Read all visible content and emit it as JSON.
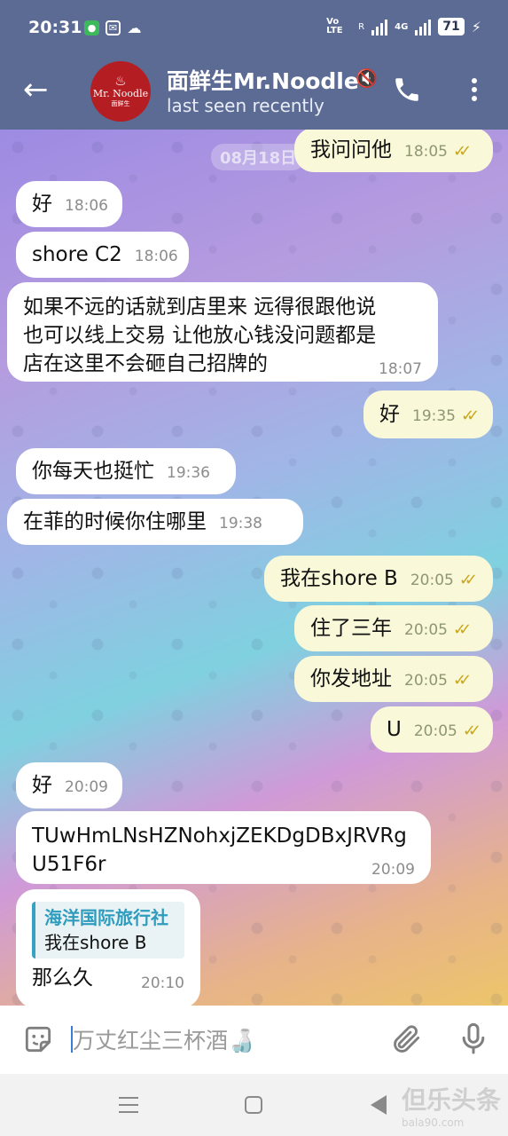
{
  "status_bar": {
    "time": "20:31",
    "network_label": "Vo LTE",
    "roaming": "R",
    "network_type": "4G",
    "battery": "71"
  },
  "header": {
    "back_icon": "arrow-left-icon",
    "avatar": {
      "line1": "Mr. Noodle",
      "line2": "面鲜生"
    },
    "title": "面鲜生Mr.Noodle",
    "subtitle": "last seen recently",
    "mute_icon": "muted-speaker-icon",
    "call_icon": "phone-icon",
    "menu_icon": "more-vertical-icon"
  },
  "chat": {
    "date_badge": "08月18日",
    "messages": [
      {
        "side": "out",
        "text": "我问问他",
        "time": "18:05",
        "read": true
      },
      {
        "side": "in",
        "text": "好",
        "time": "18:06"
      },
      {
        "side": "in",
        "text": "shore C2",
        "time": "18:06"
      },
      {
        "side": "in",
        "lines": [
          "如果不远的话就到店里来 远得很跟他说",
          "也可以线上交易 让他放心钱没问题都是",
          "店在这里不会砸自己招牌的"
        ],
        "time": "18:07"
      },
      {
        "side": "out",
        "text": "好",
        "time": "19:35",
        "read": true
      },
      {
        "side": "in",
        "text": "你每天也挺忙",
        "time": "19:36"
      },
      {
        "side": "in",
        "text": "在菲的时候你住哪里",
        "time": "19:38"
      },
      {
        "side": "out",
        "text": "我在shore B",
        "time": "20:05",
        "read": true
      },
      {
        "side": "out",
        "text": "住了三年",
        "time": "20:05",
        "read": true
      },
      {
        "side": "out",
        "text": "你发地址",
        "time": "20:05",
        "read": true
      },
      {
        "side": "out",
        "text": "U",
        "time": "20:05",
        "read": true
      },
      {
        "side": "in",
        "text": "好",
        "time": "20:09"
      },
      {
        "side": "in",
        "lines": [
          "TUwHmLNsHZNohxjZEKDgDBxJRVRg",
          "U51F6r"
        ],
        "time": "20:09"
      },
      {
        "side": "in",
        "reply_to": {
          "name": "海洋国际旅行社",
          "text": "我在shore B"
        },
        "text": "那么久",
        "time": "20:10"
      }
    ]
  },
  "composer": {
    "emoji_icon": "sticker-emoji-icon",
    "draft_text": "万丈红尘三杯酒🍶",
    "attach_icon": "paperclip-icon",
    "mic_icon": "microphone-icon"
  },
  "nav": {
    "menu_icon": "recent-apps-icon",
    "home_icon": "home-icon",
    "back_icon": "back-triangle-icon",
    "watermark": "但乐头条",
    "watermark_url": "bala90.com"
  },
  "colors": {
    "header_bg": "#5c6b93",
    "incoming_bubble": "#ffffff",
    "outgoing_bubble": "#f9f8d8",
    "read_check": "#c9a81d",
    "reply_accent": "#36a3c4",
    "avatar_bg": "#b41e23"
  }
}
